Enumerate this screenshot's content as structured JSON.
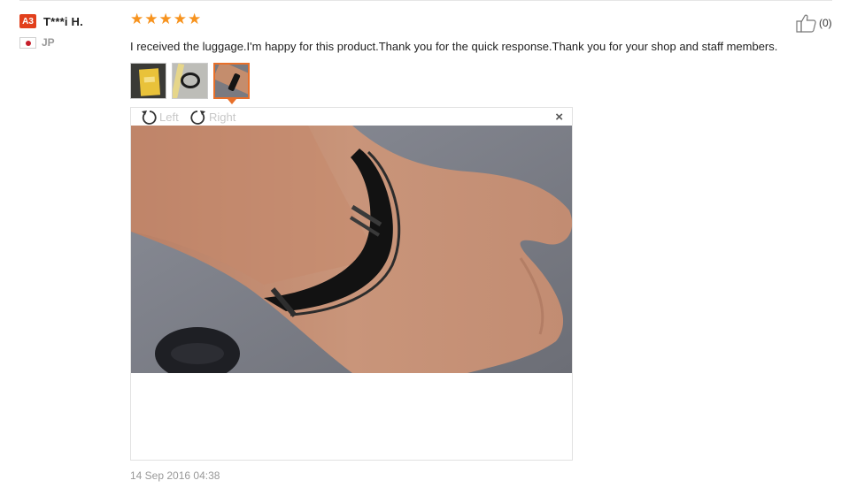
{
  "reviewer": {
    "level_badge": "A3",
    "name": "T***i H.",
    "country_code": "JP",
    "flag_icon": "japan-flag-icon"
  },
  "rating": {
    "stars": 5,
    "max": 5,
    "color": "#f7931e"
  },
  "helpful": {
    "icon": "thumbs-up-icon",
    "count_label": "(0)"
  },
  "review": {
    "text": "I received the luggage.I'm happy for this product.Thank you for the quick response.Thank you for your shop and staff members.",
    "date": "14 Sep 2016 04:38"
  },
  "photos": {
    "thumbnails": [
      "package-photo",
      "bracelet-photo",
      "wrist-photo"
    ],
    "selected_index": 2,
    "accent_color": "#e8702a"
  },
  "viewer": {
    "rotate_left_label": "Left",
    "rotate_right_label": "Right",
    "close_label": "×"
  }
}
